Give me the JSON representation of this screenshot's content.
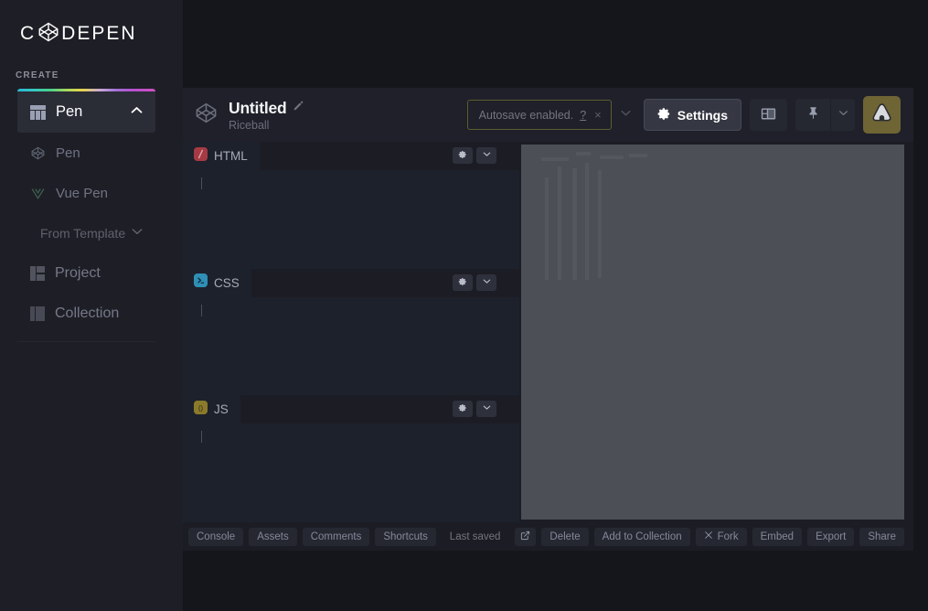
{
  "sidebar": {
    "brand": {
      "pre": "C",
      "post": "DEPEN",
      "logo_icon": "codepen-cube-icon"
    },
    "section_label": "CREATE",
    "active_item": {
      "label": "Pen",
      "icon": "pen-grid-icon",
      "chevron": "chevron-up-icon"
    },
    "items": [
      {
        "label": "Pen",
        "icon": "codepen-cube-icon"
      },
      {
        "label": "Vue Pen",
        "icon": "vue-logo-icon"
      },
      {
        "label": "From Template",
        "icon": "template-icon",
        "chevron": "chevron-down-icon"
      },
      {
        "label": "Project",
        "icon": "project-icon"
      },
      {
        "label": "Collection",
        "icon": "collection-icon"
      }
    ]
  },
  "header": {
    "pen_logo_icon": "codepen-cube-icon",
    "title": "Untitled",
    "edit_icon": "pencil-icon",
    "author": "Riceball",
    "autosave": {
      "text": "Autosave enabled.",
      "help": "?",
      "close": "×"
    },
    "autosave_chevron": "chevron-down-icon",
    "settings_label": "Settings",
    "settings_icon": "gear-icon",
    "layout_icon": "layout-view-icon",
    "pin_icon": "pin-icon",
    "pin_chevron": "chevron-down-icon",
    "avatar_icon": "onigiri-avatar-icon",
    "avatar_bg": "#6e6434"
  },
  "editors": [
    {
      "name": "HTML",
      "icon": "html5-icon",
      "icon_bg": "#a63a44",
      "gear_icon": "gear-icon",
      "chevron_icon": "chevron-down-icon",
      "code": ""
    },
    {
      "name": "CSS",
      "icon": "css-icon",
      "icon_bg": "#2f8fb5",
      "gear_icon": "gear-icon",
      "chevron_icon": "chevron-down-icon",
      "code": ""
    },
    {
      "name": "JS",
      "icon": "js-icon",
      "icon_bg": "#8a7a2a",
      "gear_icon": "gear-icon",
      "chevron_icon": "chevron-down-icon",
      "code": ""
    }
  ],
  "preview": {
    "name": "preview-pane",
    "bg": "#4d4f57"
  },
  "footer": {
    "left_buttons": [
      {
        "label": "Console"
      },
      {
        "label": "Assets"
      },
      {
        "label": "Comments"
      },
      {
        "label": "Shortcuts"
      }
    ],
    "last_saved": "Last saved",
    "right_buttons": [
      {
        "label": "",
        "icon": "external-link-icon"
      },
      {
        "label": "Delete"
      },
      {
        "label": "Add to Collection"
      },
      {
        "label": "Fork",
        "icon": "fork-icon"
      },
      {
        "label": "Embed"
      },
      {
        "label": "Export"
      },
      {
        "label": "Share"
      }
    ]
  },
  "colors": {
    "page_bg": "#15161c",
    "sidebar_bg": "#1e1f26",
    "editor_bg": "#1c1d24",
    "code_bg": "#1d212b",
    "header_bg": "#1f2029"
  }
}
